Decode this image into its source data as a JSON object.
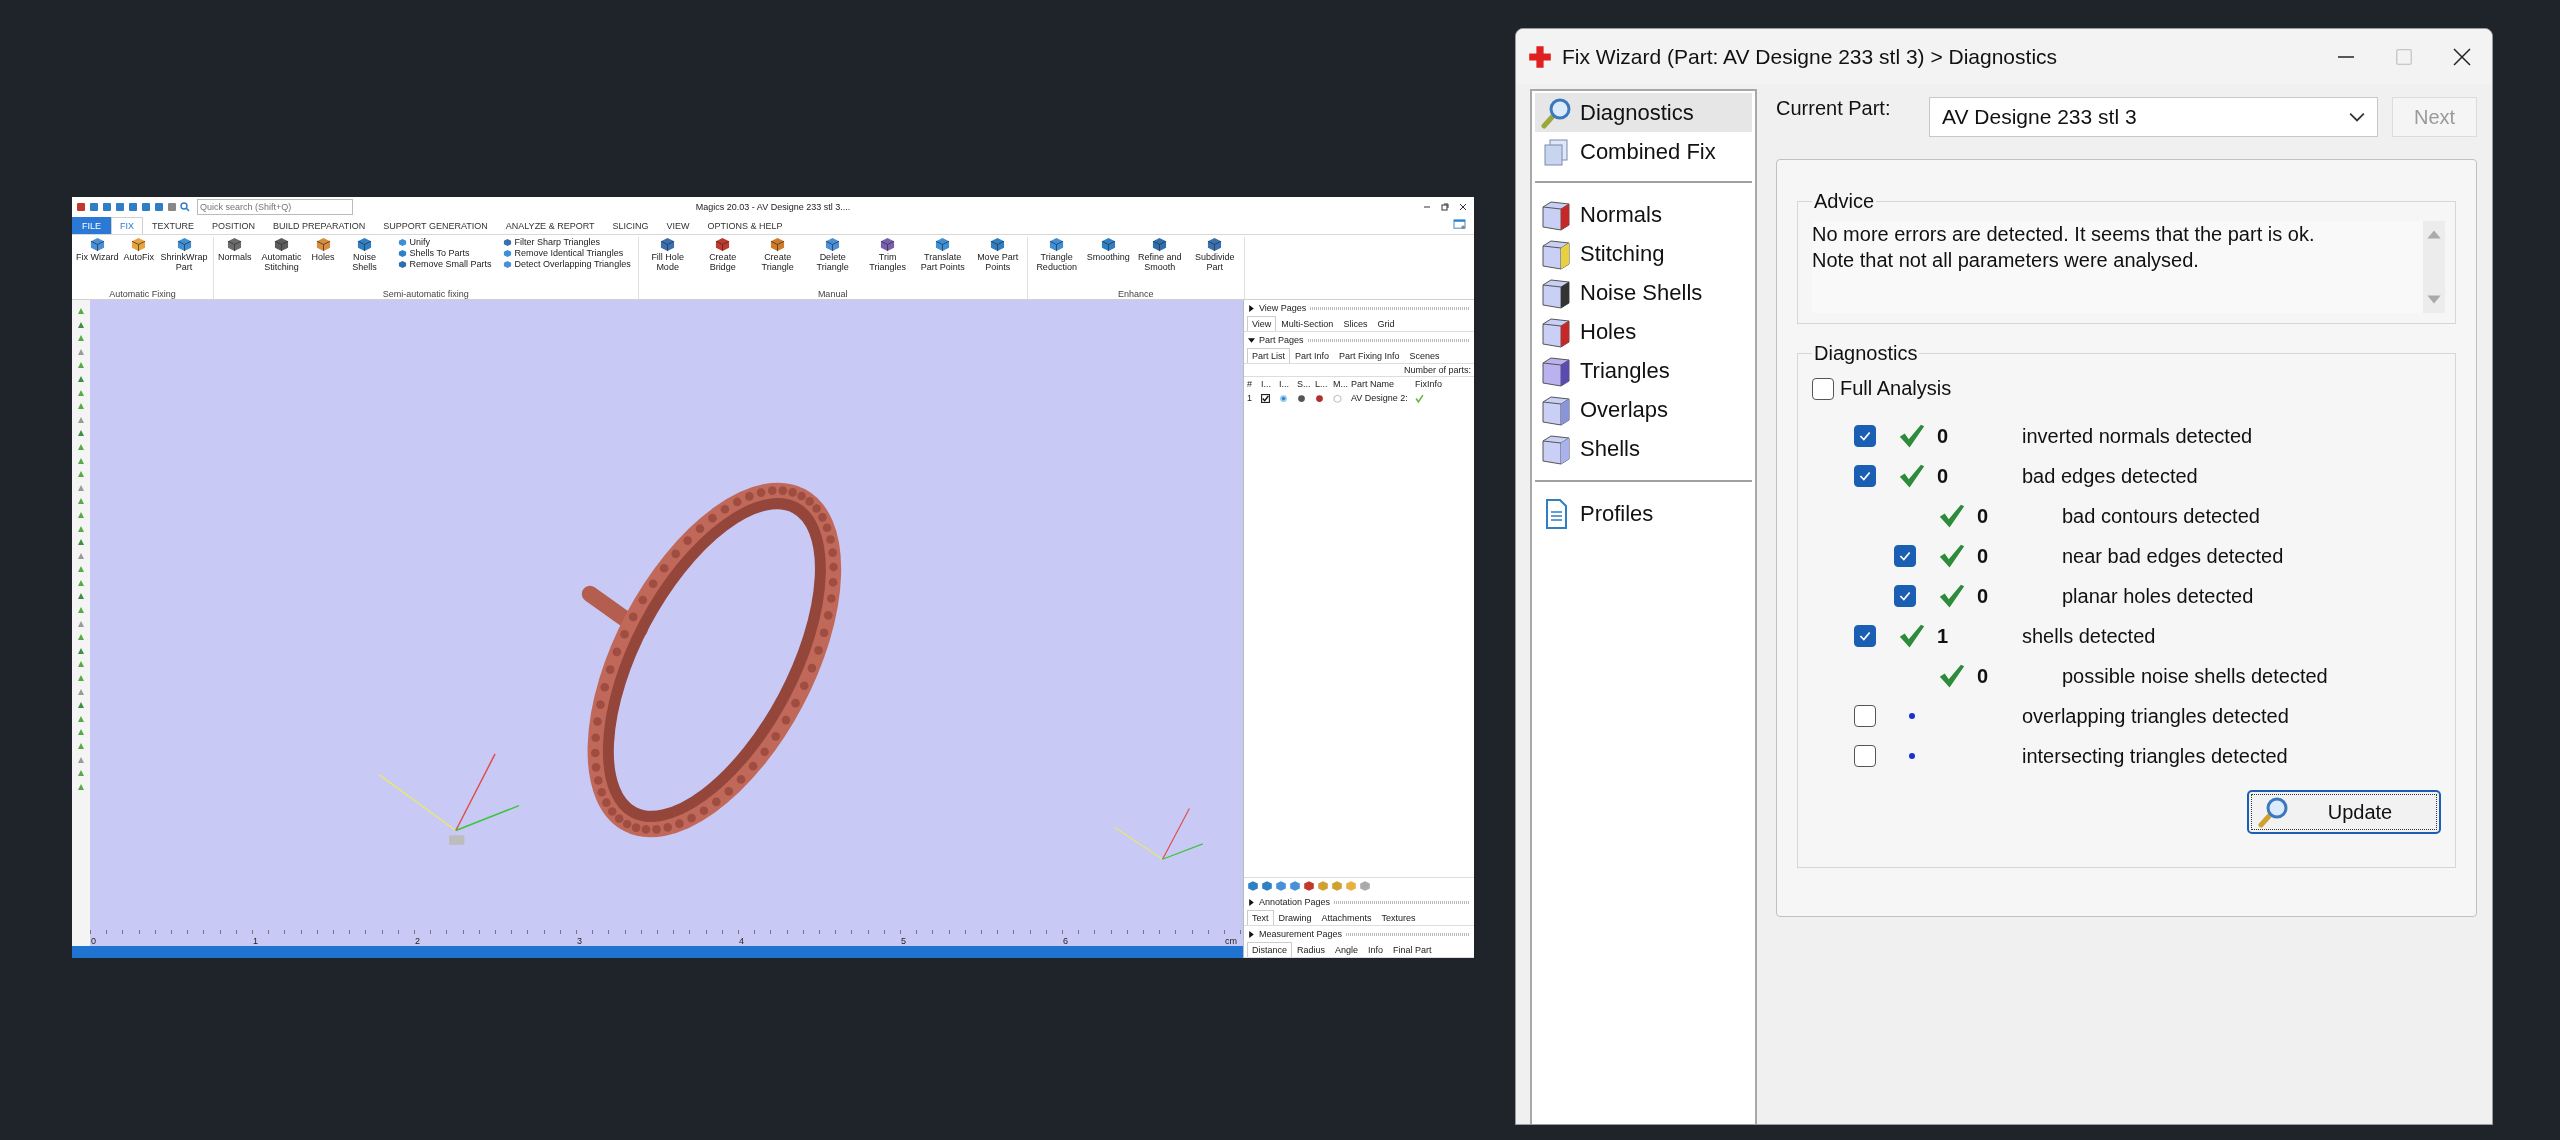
{
  "magics": {
    "title": "Magics 20.03 - AV Designe 233 stl 3....",
    "quick_search": {
      "placeholder": "Quick search (Shift+Q)"
    },
    "tabs": [
      {
        "label": "FILE",
        "kind": "file",
        "selected": false
      },
      {
        "label": "FIX",
        "kind": "tab",
        "selected": true
      },
      {
        "label": "TEXTURE",
        "kind": "tab",
        "selected": false
      },
      {
        "label": "POSITION",
        "kind": "tab",
        "selected": false
      },
      {
        "label": "BUILD PREPARATION",
        "kind": "tab",
        "selected": false
      },
      {
        "label": "SUPPORT GENERATION",
        "kind": "tab",
        "selected": false
      },
      {
        "label": "ANALYZE & REPORT",
        "kind": "tab",
        "selected": false
      },
      {
        "label": "SLICING",
        "kind": "tab",
        "selected": false
      },
      {
        "label": "VIEW",
        "kind": "tab",
        "selected": false
      },
      {
        "label": "OPTIONS & HELP",
        "kind": "tab",
        "selected": false
      }
    ],
    "ribbon_groups": [
      {
        "name": "Automatic Fixing",
        "items": [
          {
            "kind": "large",
            "label": "Fix Wizard"
          },
          {
            "kind": "large",
            "label": "AutoFix"
          },
          {
            "kind": "large",
            "label": "ShrinkWrap Part"
          }
        ]
      },
      {
        "name": "Semi-automatic fixing",
        "items": [
          {
            "kind": "large",
            "label": "Normals"
          },
          {
            "kind": "large",
            "label": "Automatic Stitching"
          },
          {
            "kind": "large",
            "label": "Holes"
          },
          {
            "kind": "large",
            "label": "Noise Shells"
          },
          {
            "kind": "stack",
            "entries": [
              "Unify",
              "Shells To Parts",
              "Remove Small Parts"
            ]
          },
          {
            "kind": "stack",
            "entries": [
              "Filter Sharp Triangles",
              "Remove Identical Triangles",
              "Detect Overlapping Triangles"
            ]
          }
        ]
      },
      {
        "name": "Manual",
        "items": [
          {
            "kind": "large",
            "label": "Fill Hole Mode"
          },
          {
            "kind": "large",
            "label": "Create Bridge"
          },
          {
            "kind": "large",
            "label": "Create Triangle"
          },
          {
            "kind": "large",
            "label": "Delete Triangle"
          },
          {
            "kind": "large",
            "label": "Trim Triangles"
          },
          {
            "kind": "large",
            "label": "Translate Part Points"
          },
          {
            "kind": "large",
            "label": "Move Part Points"
          }
        ]
      },
      {
        "name": "Enhance",
        "items": [
          {
            "kind": "large",
            "label": "Triangle Reduction"
          },
          {
            "kind": "large",
            "label": "Smoothing"
          },
          {
            "kind": "large",
            "label": "Refine and Smooth"
          },
          {
            "kind": "large",
            "label": "Subdivide Part"
          }
        ]
      }
    ],
    "ruler": {
      "labels": [
        "0",
        "1",
        "2",
        "3",
        "4",
        "5",
        "6"
      ],
      "unit": "cm"
    },
    "side_panel": {
      "view_pages": {
        "title": "View Pages",
        "expanded": false,
        "tabs": [
          {
            "label": "View",
            "selected": true
          },
          {
            "label": "Multi-Section",
            "selected": false
          },
          {
            "label": "Slices",
            "selected": false
          },
          {
            "label": "Grid",
            "selected": false
          }
        ]
      },
      "part_pages": {
        "title": "Part Pages",
        "expanded": true,
        "tabs": [
          {
            "label": "Part List",
            "selected": true
          },
          {
            "label": "Part Info",
            "selected": false
          },
          {
            "label": "Part Fixing Info",
            "selected": false
          },
          {
            "label": "Scenes",
            "selected": false
          }
        ],
        "count_label": "Number of parts:",
        "columns": [
          "#",
          "I...",
          "I...",
          "S...",
          "L...",
          "M...",
          "Part Name",
          "FixInfo"
        ],
        "rows": [
          {
            "number": "1",
            "checked": true,
            "name": "AV Designe 2:"
          }
        ]
      },
      "annotation_pages": {
        "title": "Annotation Pages",
        "expanded": false,
        "tabs": [
          {
            "label": "Text",
            "selected": true
          },
          {
            "label": "Drawing",
            "selected": false
          },
          {
            "label": "Attachments",
            "selected": false
          },
          {
            "label": "Textures",
            "selected": false
          }
        ]
      },
      "measurement_pages": {
        "title": "Measurement Pages",
        "expanded": false,
        "tabs": [
          {
            "label": "Distance",
            "selected": true
          },
          {
            "label": "Radius",
            "selected": false
          },
          {
            "label": "Angle",
            "selected": false
          },
          {
            "label": "Info",
            "selected": false
          },
          {
            "label": "Final Part",
            "selected": false
          }
        ]
      }
    }
  },
  "fix_wizard": {
    "title": "Fix Wizard (Part: AV Designe 233 stl 3) > Diagnostics",
    "nav_sections": [
      {
        "items": [
          {
            "label": "Diagnostics",
            "selected": true
          },
          {
            "label": "Combined Fix",
            "selected": false
          }
        ]
      },
      {
        "items": [
          {
            "label": "Normals",
            "selected": false
          },
          {
            "label": "Stitching",
            "selected": false
          },
          {
            "label": "Noise Shells",
            "selected": false
          },
          {
            "label": "Holes",
            "selected": false
          },
          {
            "label": "Triangles",
            "selected": false
          },
          {
            "label": "Overlaps",
            "selected": false
          },
          {
            "label": "Shells",
            "selected": false
          }
        ]
      },
      {
        "items": [
          {
            "label": "Profiles",
            "selected": false
          }
        ]
      }
    ],
    "current_part": {
      "label": "Current Part:",
      "value": "AV Designe 233 stl 3"
    },
    "next_button": {
      "label": "Next",
      "disabled": true
    },
    "advice": {
      "title": "Advice",
      "lines": [
        "No more errors are detected. It seems that the part is ok.",
        "Note that not all parameters were analysed."
      ]
    },
    "diagnostics": {
      "title": "Diagnostics",
      "full_analysis": {
        "label": "Full Analysis",
        "checked": false
      },
      "rows": [
        {
          "kind": "check",
          "checked": true,
          "passed": true,
          "count": "0",
          "label": "inverted normals detected"
        },
        {
          "kind": "check",
          "checked": true,
          "passed": true,
          "count": "0",
          "label": "bad edges detected",
          "children": [
            {
              "kind": "info",
              "passed": true,
              "count": "0",
              "label": "bad contours detected"
            },
            {
              "kind": "check",
              "checked": true,
              "passed": true,
              "count": "0",
              "label": "near bad edges detected"
            },
            {
              "kind": "check",
              "checked": true,
              "passed": true,
              "count": "0",
              "label": "planar holes detected"
            }
          ]
        },
        {
          "kind": "check",
          "checked": true,
          "passed": true,
          "count": "1",
          "label": "shells detected",
          "children": [
            {
              "kind": "info",
              "passed": true,
              "count": "0",
              "label": "possible noise shells detected"
            }
          ]
        },
        {
          "kind": "check",
          "checked": false,
          "passed": false,
          "label": "overlapping triangles detected"
        },
        {
          "kind": "check",
          "checked": false,
          "passed": false,
          "label": "intersecting triangles detected"
        }
      ],
      "update_button": {
        "label": "Update"
      }
    }
  }
}
